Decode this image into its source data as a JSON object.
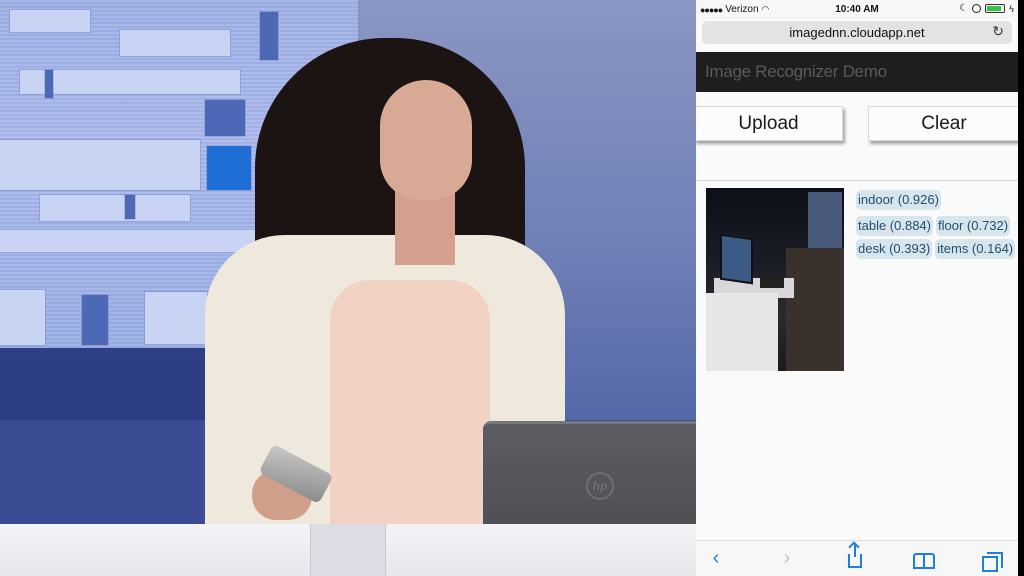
{
  "stage": {
    "laptop_logo": "hp"
  },
  "phone": {
    "status_bar": {
      "signal": "●●●●●",
      "carrier": "Verizon",
      "wifi_icon": "wifi-icon",
      "time": "10:40 AM",
      "battery_level": 0.85,
      "battery_color": "#3bc14a"
    },
    "browser": {
      "url": "imagednn.cloudapp.net",
      "reload_icon": "↻"
    },
    "app": {
      "title": "Image Recognizer Demo",
      "upload_label": "Upload",
      "clear_label": "Clear",
      "tags": [
        {
          "label": "indoor (0.926)"
        },
        {
          "label": "table (0.884)"
        },
        {
          "label": "floor (0.732)"
        },
        {
          "label": "desk (0.393)"
        },
        {
          "label": "items (0.164)"
        }
      ]
    },
    "toolbar": {
      "back_icon": "‹",
      "forward_icon": "›",
      "accent_color": "#1f7fe0"
    }
  }
}
